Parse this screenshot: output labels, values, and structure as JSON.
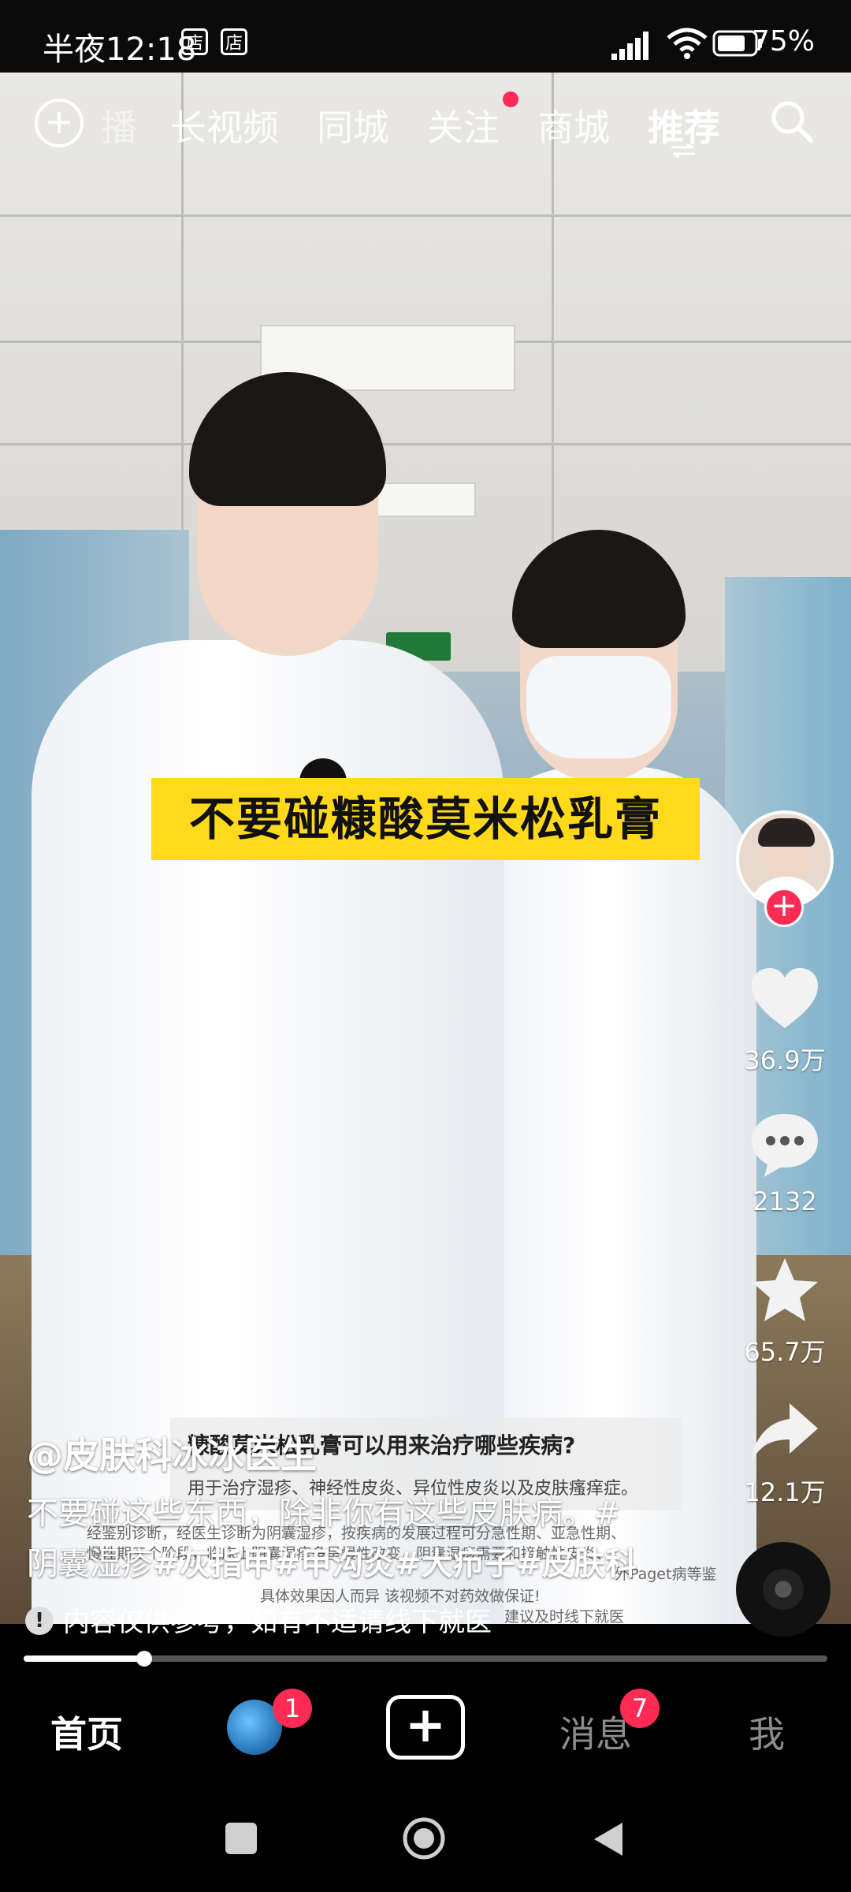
{
  "status_bar": {
    "time": "半夜12:18",
    "shop_icons": [
      "店",
      "店"
    ],
    "battery": "75%"
  },
  "top_nav": {
    "partial_tab": "播",
    "tabs": [
      "长视频",
      "同城",
      "关注",
      "商城",
      "推荐"
    ],
    "active_tab": "推荐"
  },
  "video": {
    "caption": "不要碰糠酸莫米松乳膏",
    "info_card": {
      "title": "糠酸莫米松乳膏可以用来治疗哪些疾病?",
      "subtitle": "用于治疗湿疹、神经性皮炎、异位性皮炎以及皮肤瘙痒症。"
    },
    "fine_print": [
      "经鉴别诊断，经医生诊断为阴囊湿疹，按疾病的发展过程可分急性期、亚急性期、",
      "慢性期三个阶段，临床上阴囊湿疹多呈慢性改变，阴囊湿疹需要和接触性皮炎、",
      "外Paget病等鉴",
      "具体效果因人而异 该视频不对药效做保证!",
      "建议及时线下就医"
    ]
  },
  "rail": {
    "likes": "36.9万",
    "comments": "2132",
    "favorites": "65.7万",
    "shares": "12.1万"
  },
  "post": {
    "author": "@皮肤科冰冰医生",
    "description": "不要碰这些东西，除非你有这些皮肤病。#",
    "description_line2_plain": "阴囊湿疹",
    "hashtags": "#灰指甲#甲沟炎#大疖子#皮肤科",
    "notice": "内容仅供参考，如有不适请线下就医"
  },
  "progress": 0.15,
  "bottom_tabs": {
    "home": "首页",
    "friends_badge": "1",
    "messages": "消息",
    "messages_badge": "7",
    "me": "我"
  },
  "colors": {
    "caption_bg": "#ffd91a",
    "badge": "#fe2c55",
    "nav_dot": "#ff2a55"
  }
}
